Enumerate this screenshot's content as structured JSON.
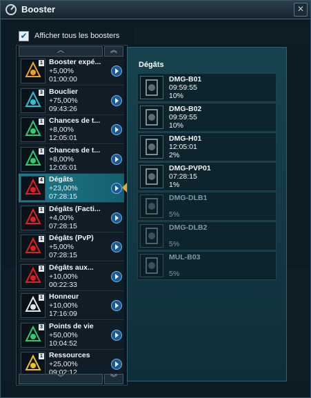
{
  "window": {
    "title": "Booster"
  },
  "show_all": {
    "label": "Afficher tous les boosters",
    "checked": true
  },
  "list": {
    "items": [
      {
        "name": "Booster expé...",
        "pct": "+5,00%",
        "time": "01:00:00",
        "level": "1",
        "icon": "experience-booster-icon",
        "color": "#f2a020"
      },
      {
        "name": "Bouclier",
        "pct": "+75,00%",
        "time": "09:43:26",
        "level": "3",
        "icon": "shield-booster-icon",
        "color": "#26c6da"
      },
      {
        "name": "Chances de t...",
        "pct": "+8,00%",
        "time": "12:05:01",
        "level": "1",
        "icon": "hit-chance-booster-icon",
        "color": "#2ecc71"
      },
      {
        "name": "Chances de t...",
        "pct": "+8,00%",
        "time": "12:05:01",
        "level": "1",
        "icon": "hit-chance-booster-icon",
        "color": "#2ecc71"
      },
      {
        "name": "Dégâts",
        "pct": "+23,00%",
        "time": "07:28:15",
        "level": "4",
        "icon": "damage-booster-icon",
        "color": "#e02020",
        "selected": true
      },
      {
        "name": "Dégâts (Facti...",
        "pct": "+4,00%",
        "time": "07:28:15",
        "level": "1",
        "icon": "faction-damage-booster-icon",
        "color": "#e02020"
      },
      {
        "name": "Dégâts (PvP)",
        "pct": "+5,00%",
        "time": "07:28:15",
        "level": "1",
        "icon": "pvp-damage-booster-icon",
        "color": "#e02020"
      },
      {
        "name": "Dégâts aux...",
        "pct": "+10,00%",
        "time": "00:22:33",
        "level": "1",
        "icon": "damage-aux-booster-icon",
        "color": "#e02020"
      },
      {
        "name": "Honneur",
        "pct": "+10,00%",
        "time": "17:16:09",
        "level": "1",
        "icon": "honor-booster-icon",
        "color": "#e8e8e8"
      },
      {
        "name": "Points de vie",
        "pct": "+50,00%",
        "time": "10:04:52",
        "level": "3",
        "icon": "hitpoints-booster-icon",
        "color": "#2ecc71"
      },
      {
        "name": "Ressources",
        "pct": "+25,00%",
        "time": "09:02:12",
        "level": "1",
        "icon": "resources-booster-icon",
        "color": "#f2c020"
      }
    ]
  },
  "details": {
    "title": "Dégâts",
    "items": [
      {
        "name": "DMG-B01",
        "time": "09:59:55",
        "pct": "10%",
        "active": true
      },
      {
        "name": "DMG-B02",
        "time": "09:59:55",
        "pct": "10%",
        "active": true
      },
      {
        "name": "DMG-H01",
        "time": "12:05:01",
        "pct": "2%",
        "active": true
      },
      {
        "name": "DMG-PVP01",
        "time": "07:28:15",
        "pct": "1%",
        "active": true
      },
      {
        "name": "DMG-DLB1",
        "time": "",
        "pct": "5%",
        "active": false
      },
      {
        "name": "DMG-DLB2",
        "time": "",
        "pct": "5%",
        "active": false
      },
      {
        "name": "MUL-B03",
        "time": "",
        "pct": "5%",
        "active": false
      }
    ]
  }
}
